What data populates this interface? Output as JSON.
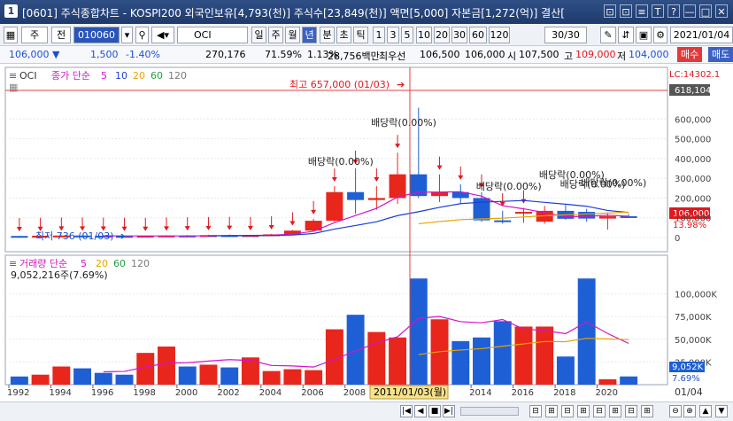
{
  "window": {
    "badge": "1",
    "title": "[0601] 주식종합차트 - KOSPI200 외국인보유[4,793(천)] 주식수[23,849(천)] 액면[5,000] 자본금[1,272(억)] 결산[",
    "buttons": [
      "⊡",
      "⊡",
      "≡",
      "T",
      "?",
      "—",
      "□",
      "✕"
    ]
  },
  "toolbar": {
    "market": "주",
    "type": "전",
    "code": "010060",
    "name": "OCI",
    "periods": [
      "일",
      "주",
      "월",
      "년",
      "분",
      "초",
      "틱"
    ],
    "active_period": "년",
    "intervals": [
      "1",
      "3",
      "5",
      "10",
      "20",
      "30",
      "60",
      "120"
    ],
    "count": "30/30",
    "date": "2021/01/04"
  },
  "info": {
    "price": "106,000 ▼",
    "change": "1,500",
    "pct": "-1.40%",
    "volume": "270,176",
    "ratio1": "71.59%",
    "ratio2": "1.13%",
    "amount": "28,756백만",
    "pref_label": "최우선",
    "bid1": "106,500",
    "bid2": "106,000",
    "open_label": "시",
    "open": "107,500",
    "high_label": "고",
    "high": "109,000",
    "low_label": "저",
    "low": "104,000",
    "buy": "매수",
    "sell": "매도"
  },
  "price_panel": {
    "symbol": "OCI",
    "legend_prefix": "종가 단순",
    "ma": [
      "5",
      "10",
      "20",
      "60",
      "120"
    ],
    "ma_colors": [
      "#d214c8",
      "#1a3cd6",
      "#e6a400",
      "#20a040",
      "#7b7b7b"
    ],
    "high_annot": "최고 657,000 (01/03)",
    "low_annot": "최저 736 (01/03)",
    "dividend_label": "배당락(0.00%)",
    "lc": "LC:14302.1",
    "current_tag": "618,104",
    "price_tag": "106,000",
    "pct_tag": "13.98%",
    "yticks": [
      "600,000",
      "500,000",
      "400,000",
      "300,000",
      "200,000",
      "100,000",
      "0"
    ]
  },
  "volume_panel": {
    "legend_prefix": "거래량 단순",
    "ma": [
      "5",
      "20",
      "60",
      "120"
    ],
    "value_text": "9,052,216주(7.69%)",
    "tag": "9,052K",
    "pct_tag": "7.69%",
    "yticks": [
      "100,000K",
      "75,000K",
      "50,000K",
      "25,000K"
    ]
  },
  "xaxis": {
    "years": [
      "1992",
      "1994",
      "1996",
      "1998",
      "2000",
      "2002",
      "2004",
      "2006",
      "2008",
      "2014",
      "2016",
      "2018",
      "2020"
    ],
    "cursor_label": "2011/01/03(월)",
    "right_label": "01/04"
  },
  "chart_data": {
    "type": "candlestick",
    "x": [
      1992,
      1993,
      1994,
      1995,
      1996,
      1997,
      1998,
      1999,
      2000,
      2001,
      2002,
      2003,
      2004,
      2005,
      2006,
      2007,
      2008,
      2009,
      2010,
      2011,
      2012,
      2013,
      2014,
      2015,
      2016,
      2017,
      2018,
      2019,
      2020,
      2021
    ],
    "open": [
      8000,
      7000,
      9000,
      10000,
      9000,
      8000,
      5000,
      9000,
      10000,
      9000,
      12000,
      10000,
      12000,
      16000,
      35000,
      85000,
      230000,
      190000,
      200000,
      320000,
      210000,
      230000,
      200000,
      87000,
      125000,
      80000,
      135000,
      130000,
      96000,
      108000
    ],
    "close": [
      7000,
      9000,
      10000,
      9000,
      8000,
      5000,
      9000,
      10000,
      9000,
      12000,
      10000,
      12000,
      16000,
      35000,
      85000,
      230000,
      190000,
      200000,
      320000,
      210000,
      230000,
      200000,
      87000,
      80000,
      130000,
      135000,
      95000,
      96000,
      107500,
      106000
    ],
    "high": [
      9000,
      10000,
      12000,
      12000,
      11000,
      10000,
      10000,
      12000,
      13000,
      14000,
      15000,
      14000,
      18000,
      38000,
      95000,
      260000,
      350000,
      260000,
      430000,
      657000,
      320000,
      270000,
      230000,
      135000,
      150000,
      160000,
      165000,
      145000,
      125000,
      118000
    ],
    "low": [
      6000,
      6000,
      8000,
      8000,
      7000,
      4000,
      736,
      8000,
      8000,
      8000,
      9000,
      9000,
      11000,
      14000,
      33000,
      80000,
      120000,
      140000,
      170000,
      200000,
      180000,
      170000,
      80000,
      70000,
      75000,
      70000,
      90000,
      80000,
      40000,
      100000
    ],
    "volume_k": [
      9000,
      11000,
      20000,
      18000,
      13000,
      11000,
      35000,
      42000,
      20000,
      22000,
      19000,
      30000,
      15000,
      17000,
      16000,
      61000,
      77000,
      58000,
      52000,
      117000,
      72000,
      48000,
      52000,
      70000,
      64000,
      64000,
      31000,
      117000,
      6000,
      9052
    ],
    "ylim": [
      0,
      700000
    ],
    "volume_ylim": [
      0,
      125000
    ]
  }
}
